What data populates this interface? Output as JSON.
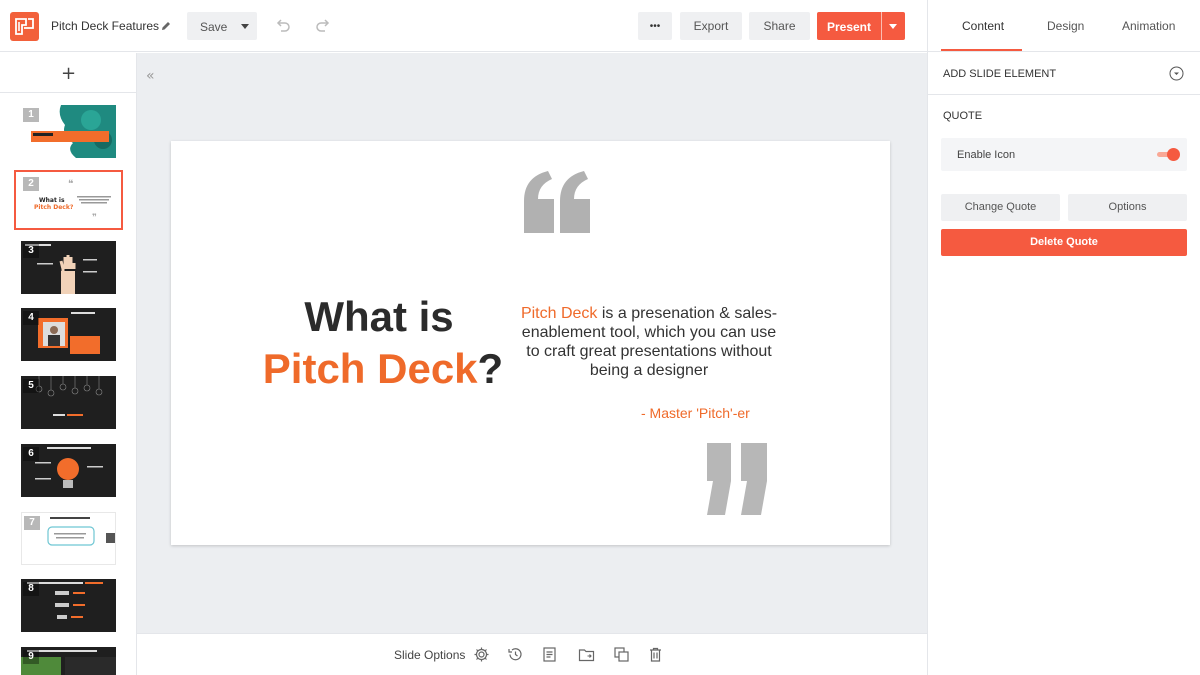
{
  "app": {
    "doc_title": "Pitch Deck Features",
    "accent_color": "#f55a40"
  },
  "toolbar": {
    "save_label": "Save",
    "more_label": "•••",
    "export_label": "Export",
    "share_label": "Share",
    "present_label": "Present"
  },
  "right_panel": {
    "tabs": [
      {
        "label": "Content",
        "active": true
      },
      {
        "label": "Design",
        "active": false
      },
      {
        "label": "Animation",
        "active": false
      }
    ],
    "add_element_label": "ADD SLIDE ELEMENT",
    "section_title": "QUOTE",
    "enable_icon_label": "Enable Icon",
    "enable_icon_on": true,
    "change_quote_label": "Change Quote",
    "options_label": "Options",
    "delete_quote_label": "Delete Quote"
  },
  "sidebar": {
    "add_label": "+",
    "slides": [
      {
        "num": "1",
        "theme": "teal-photo"
      },
      {
        "num": "2",
        "theme": "light",
        "selected": true
      },
      {
        "num": "3",
        "theme": "dark"
      },
      {
        "num": "4",
        "theme": "dark"
      },
      {
        "num": "5",
        "theme": "dark"
      },
      {
        "num": "6",
        "theme": "dark"
      },
      {
        "num": "7",
        "theme": "light"
      },
      {
        "num": "8",
        "theme": "dark"
      },
      {
        "num": "9",
        "theme": "dark"
      }
    ]
  },
  "slide": {
    "title_line1": "What is",
    "title_accent": "Pitch Deck",
    "title_suffix": "?",
    "quote_accent": "Pitch Deck",
    "quote_rest": " is a presenation & sales-enablement tool, which you can use to craft great presentations without being a designer",
    "author": "- Master 'Pitch'-er"
  },
  "bottom": {
    "slide_options_label": "Slide Options"
  }
}
